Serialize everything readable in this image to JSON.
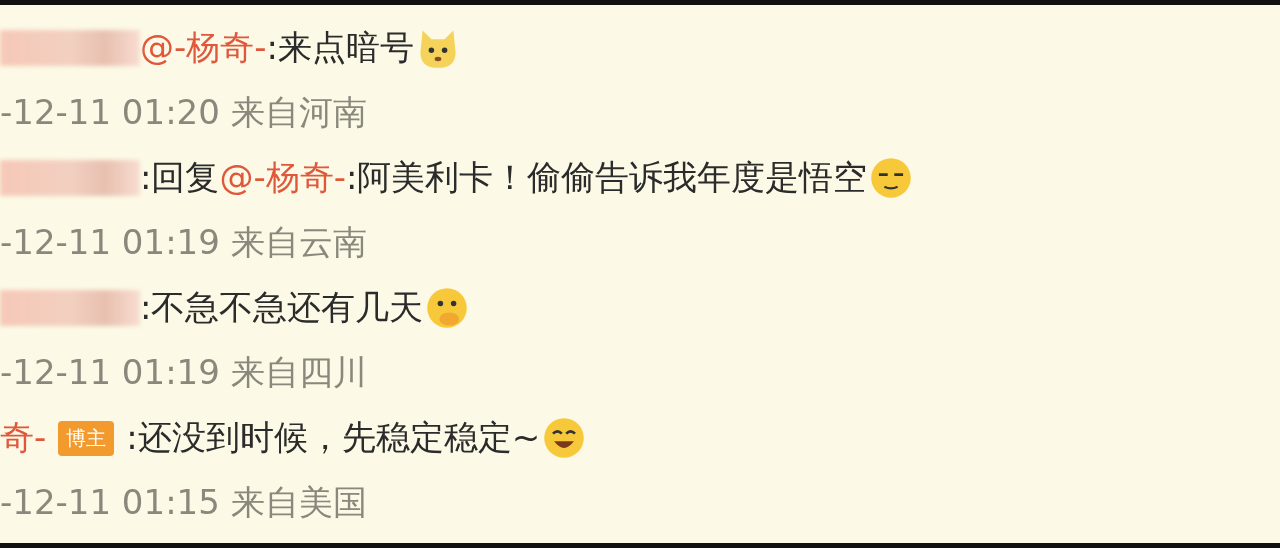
{
  "comments": [
    {
      "parts": [
        {
          "kind": "blur"
        },
        {
          "kind": "mention",
          "text": "@-杨奇-"
        },
        {
          "kind": "text",
          "text": ":来点暗号"
        },
        {
          "kind": "cat"
        }
      ],
      "meta": "-12-11 01:20 来自河南"
    },
    {
      "parts": [
        {
          "kind": "blur"
        },
        {
          "kind": "text",
          "text": ":回复"
        },
        {
          "kind": "mention",
          "text": "@-杨奇-"
        },
        {
          "kind": "text",
          "text": ":阿美利卡！偷偷告诉我年度是悟空"
        },
        {
          "kind": "smug"
        }
      ],
      "meta": "-12-11 01:19 来自云南"
    },
    {
      "parts": [
        {
          "kind": "blur"
        },
        {
          "kind": "text",
          "text": ":不急不急还有几天"
        },
        {
          "kind": "shy"
        }
      ],
      "meta": "-12-11 01:19 来自四川"
    },
    {
      "parts": [
        {
          "kind": "mention",
          "text": "奇-"
        },
        {
          "kind": "badge",
          "text": "博主"
        },
        {
          "kind": "text",
          "text": ":还没到时候，先稳定稳定~"
        },
        {
          "kind": "grin"
        }
      ],
      "meta": "-12-11 01:15 来自美国"
    }
  ]
}
